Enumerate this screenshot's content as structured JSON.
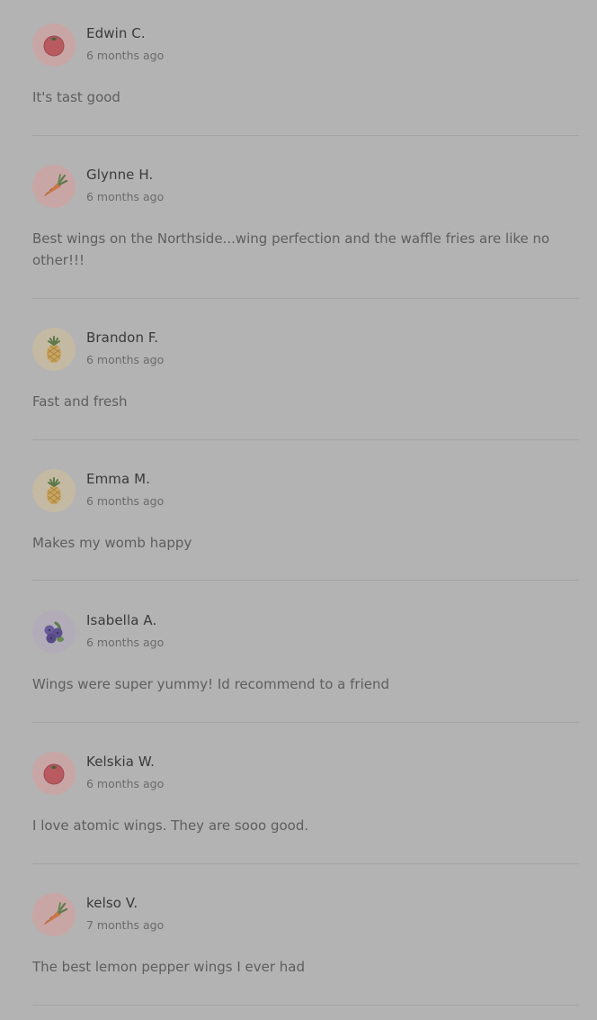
{
  "colors": {
    "background": "#b3b3b3",
    "avatar_red": "#c9a6a6",
    "avatar_yellow": "#c4b9a3",
    "avatar_purple": "#b1acb8"
  },
  "reviews": [
    {
      "name": "Edwin C.",
      "time": "6 months ago",
      "text": "It's tast good",
      "avatar": "tomato-icon"
    },
    {
      "name": "Glynne H.",
      "time": "6 months ago",
      "text": "Best wings on the Northside...wing perfection and the waffle fries are like no other!!!",
      "avatar": "carrot-icon"
    },
    {
      "name": "Brandon F.",
      "time": "6 months ago",
      "text": "Fast and fresh",
      "avatar": "pineapple-icon"
    },
    {
      "name": "Emma M.",
      "time": "6 months ago",
      "text": "Makes my womb happy",
      "avatar": "pineapple-icon"
    },
    {
      "name": "Isabella A.",
      "time": "6 months ago",
      "text": "Wings were super yummy! Id recommend to a friend",
      "avatar": "blueberry-icon"
    },
    {
      "name": "Kelskia W.",
      "time": "6 months ago",
      "text": "I love atomic wings. They are sooo good.",
      "avatar": "tomato-icon"
    },
    {
      "name": "kelso V.",
      "time": "7 months ago",
      "text": "The best lemon pepper wings I ever had",
      "avatar": "carrot-icon"
    }
  ]
}
